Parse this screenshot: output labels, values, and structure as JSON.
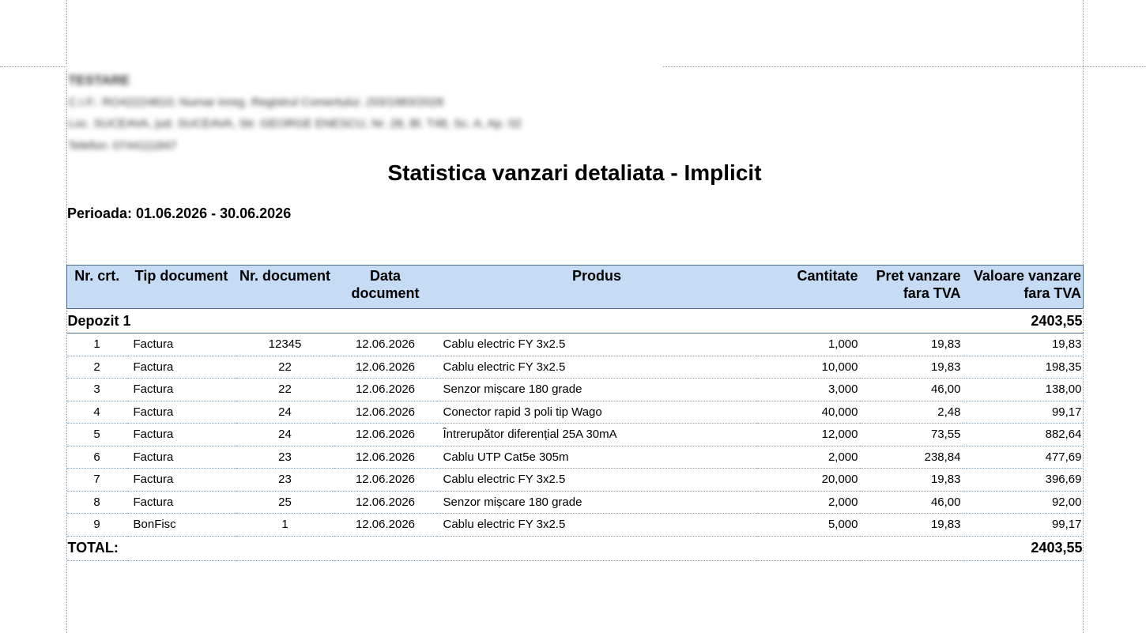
{
  "company": {
    "name": "TESTARE",
    "lines": [
      "C.I.F.: RO42224810; Numar inreg. Registrul Comertului: J33/1983/2028",
      "Loc. SUCEAVA, jud. SUCEAVA, Str. GEORGE ENESCU, Nr. 28, Bl. T48, Sc. A, Ap. 02",
      "Telefon: 0744111847"
    ]
  },
  "report": {
    "title": "Statistica vanzari detaliata - Implicit",
    "period": "Perioada: 01.06.2026 - 30.06.2026"
  },
  "table": {
    "headers": {
      "nr_crt": "Nr. crt.",
      "tip_document": "Tip document",
      "nr_document": "Nr. document",
      "data_document": "Data document",
      "produs": "Produs",
      "cantitate": "Cantitate",
      "pret_vanzare": "Pret vanzare fara TVA",
      "valoare_vanzare": "Valoare vanzare fara TVA"
    },
    "group": {
      "label": "Depozit 1",
      "total": "2403,55"
    },
    "rows": [
      {
        "nr": "1",
        "tip": "Factura",
        "doc": "12345",
        "data": "12.06.2026",
        "produs": "Cablu electric FY 3x2.5",
        "cant": "1,000",
        "pret": "19,83",
        "valoare": "19,83"
      },
      {
        "nr": "2",
        "tip": "Factura",
        "doc": "22",
        "data": "12.06.2026",
        "produs": "Cablu electric FY 3x2.5",
        "cant": "10,000",
        "pret": "19,83",
        "valoare": "198,35"
      },
      {
        "nr": "3",
        "tip": "Factura",
        "doc": "22",
        "data": "12.06.2026",
        "produs": "Senzor mișcare 180 grade",
        "cant": "3,000",
        "pret": "46,00",
        "valoare": "138,00"
      },
      {
        "nr": "4",
        "tip": "Factura",
        "doc": "24",
        "data": "12.06.2026",
        "produs": "Conector rapid 3 poli tip Wago",
        "cant": "40,000",
        "pret": "2,48",
        "valoare": "99,17"
      },
      {
        "nr": "5",
        "tip": "Factura",
        "doc": "24",
        "data": "12.06.2026",
        "produs": "Întrerupător diferențial 25A 30mA",
        "cant": "12,000",
        "pret": "73,55",
        "valoare": "882,64"
      },
      {
        "nr": "6",
        "tip": "Factura",
        "doc": "23",
        "data": "12.06.2026",
        "produs": "Cablu UTP Cat5e 305m",
        "cant": "2,000",
        "pret": "238,84",
        "valoare": "477,69"
      },
      {
        "nr": "7",
        "tip": "Factura",
        "doc": "23",
        "data": "12.06.2026",
        "produs": "Cablu electric FY 3x2.5",
        "cant": "20,000",
        "pret": "19,83",
        "valoare": "396,69"
      },
      {
        "nr": "8",
        "tip": "Factura",
        "doc": "25",
        "data": "12.06.2026",
        "produs": "Senzor mișcare 180 grade",
        "cant": "2,000",
        "pret": "46,00",
        "valoare": "92,00"
      },
      {
        "nr": "9",
        "tip": "BonFisc",
        "doc": "1",
        "data": "12.06.2026",
        "produs": "Cablu electric FY 3x2.5",
        "cant": "5,000",
        "pret": "19,83",
        "valoare": "99,17"
      }
    ],
    "total": {
      "label": "TOTAL:",
      "value": "2403,55"
    }
  },
  "colors": {
    "header_bg": "#c6dcf4",
    "border": "#4b6b8a"
  }
}
